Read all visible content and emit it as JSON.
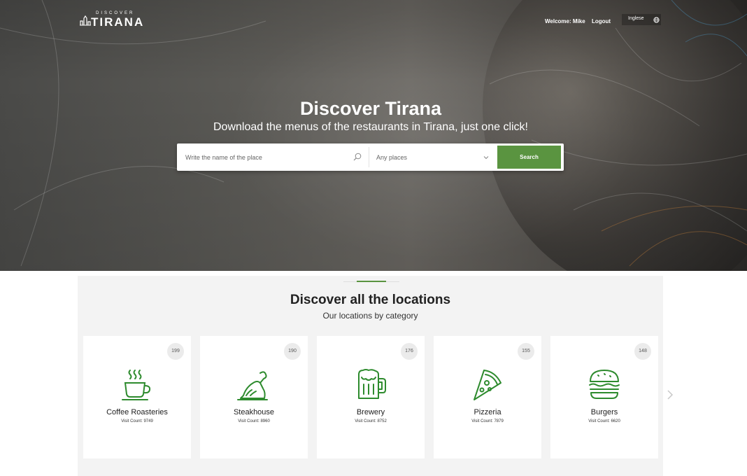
{
  "header": {
    "logo_small": "DISCOVER",
    "logo_big": "TIRANA",
    "welcome": "Welcome: Mike",
    "logout": "Logout",
    "language": "Inglese"
  },
  "hero": {
    "title": "Discover Tirana",
    "subtitle": "Download the menus of the restaurants in Tirana, just one click!"
  },
  "search": {
    "placeholder": "Write the name of the place",
    "select_value": "Any places",
    "button": "Search"
  },
  "section": {
    "title": "Discover all the locations",
    "subtitle": "Our locations by category"
  },
  "categories": [
    {
      "name": "Coffee Roasteries",
      "count": "199",
      "visits": "Visit Count: 9749",
      "icon": "coffee-icon"
    },
    {
      "name": "Steakhouse",
      "count": "190",
      "visits": "Visit Count: 8960",
      "icon": "chicken-leg-icon"
    },
    {
      "name": "Brewery",
      "count": "176",
      "visits": "Visit Count: 8752",
      "icon": "beer-mug-icon"
    },
    {
      "name": "Pizzeria",
      "count": "155",
      "visits": "Visit Count: 7879",
      "icon": "pizza-slice-icon"
    },
    {
      "name": "Burgers",
      "count": "148",
      "visits": "Visit Count: 6620",
      "icon": "burger-icon"
    }
  ],
  "colors": {
    "accent": "#5a9440",
    "icon_green": "#2e8b2e",
    "section_bg": "#f3f3f3"
  }
}
